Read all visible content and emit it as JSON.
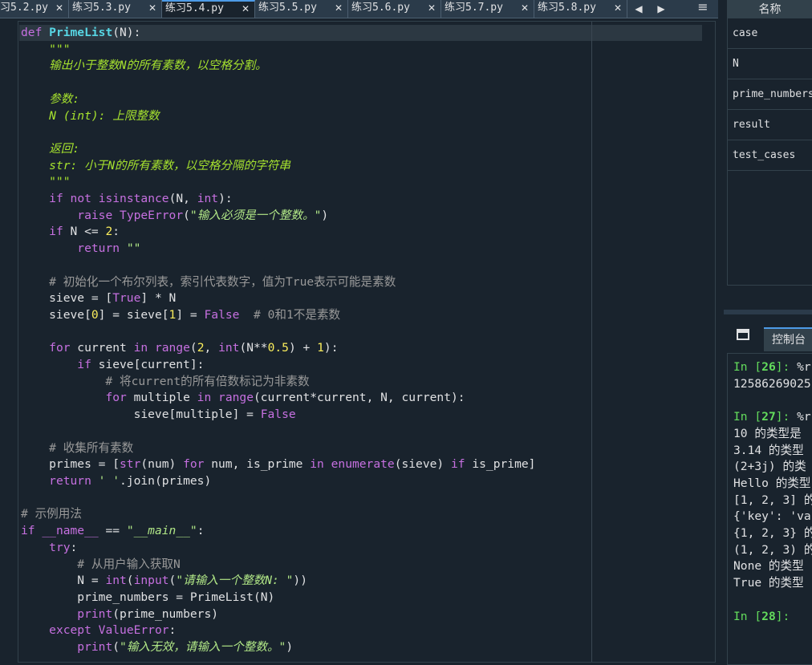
{
  "editor": {
    "tabs": [
      {
        "label": "习5.2.py",
        "active": false
      },
      {
        "label": "练习5.3.py",
        "active": false
      },
      {
        "label": "练习5.4.py",
        "active": true
      },
      {
        "label": "练习5.5.py",
        "active": false
      },
      {
        "label": "练习5.6.py",
        "active": false
      },
      {
        "label": "练习5.7.py",
        "active": false
      },
      {
        "label": "练习5.8.py",
        "active": false
      }
    ],
    "close_glyph": "✕",
    "nav_left_glyph": "◀",
    "nav_right_glyph": "▶",
    "menu_glyph": "≡",
    "lines": [
      "def PrimeList(N):",
      "    \"\"\"",
      "    输出小于整数N的所有素数，以空格分割。",
      "",
      "    参数:",
      "    N (int): 上限整数",
      "",
      "    返回:",
      "    str: 小于N的所有素数，以空格分隔的字符串",
      "    \"\"\"",
      "    if not isinstance(N, int):",
      "        raise TypeError(\"输入必须是一个整数。\")",
      "    if N <= 2:",
      "        return \"\"",
      "",
      "    # 初始化一个布尔列表，索引代表数字，值为True表示可能是素数",
      "    sieve = [True] * N",
      "    sieve[0] = sieve[1] = False  # 0和1不是素数",
      "",
      "    for current in range(2, int(N**0.5) + 1):",
      "        if sieve[current]:",
      "            # 将current的所有倍数标记为非素数",
      "            for multiple in range(current*current, N, current):",
      "                sieve[multiple] = False",
      "",
      "    # 收集所有素数",
      "    primes = [str(num) for num, is_prime in enumerate(sieve) if is_prime]",
      "    return ' '.join(primes)",
      "",
      "# 示例用法",
      "if __name__ == \"__main__\":",
      "    try:",
      "        # 从用户输入获取N",
      "        N = int(input(\"请输入一个整数N: \"))",
      "        prime_numbers = PrimeList(N)",
      "        print(prime_numbers)",
      "    except ValueError:",
      "        print(\"输入无效，请输入一个整数。\")"
    ]
  },
  "variable_explorer": {
    "header": "名称",
    "items": [
      "case",
      "N",
      "prime_numbers",
      "result",
      "test_cases"
    ]
  },
  "console": {
    "tab_label": "控制台",
    "lines": [
      "In [26]: %r",
      "12586269025",
      "",
      "In [27]: %r",
      "10 的类型是",
      "3.14 的类型",
      "(2+3j) 的类",
      "Hello 的类型",
      "[1, 2, 3] 的",
      "{'key': 'va",
      "{1, 2, 3} 的",
      "(1, 2, 3) 的",
      "None 的类型",
      "True 的类型",
      "",
      "In [28]:"
    ]
  },
  "colors": {
    "background": "#19232d",
    "keyword": "#c670e0",
    "function_name": "#57d6e4",
    "docstring": "#a6e22e",
    "string": "#b0e686",
    "number": "#faed5c",
    "comment": "#999999",
    "prompt": "#63dc5c",
    "accent": "#4d9be6"
  }
}
